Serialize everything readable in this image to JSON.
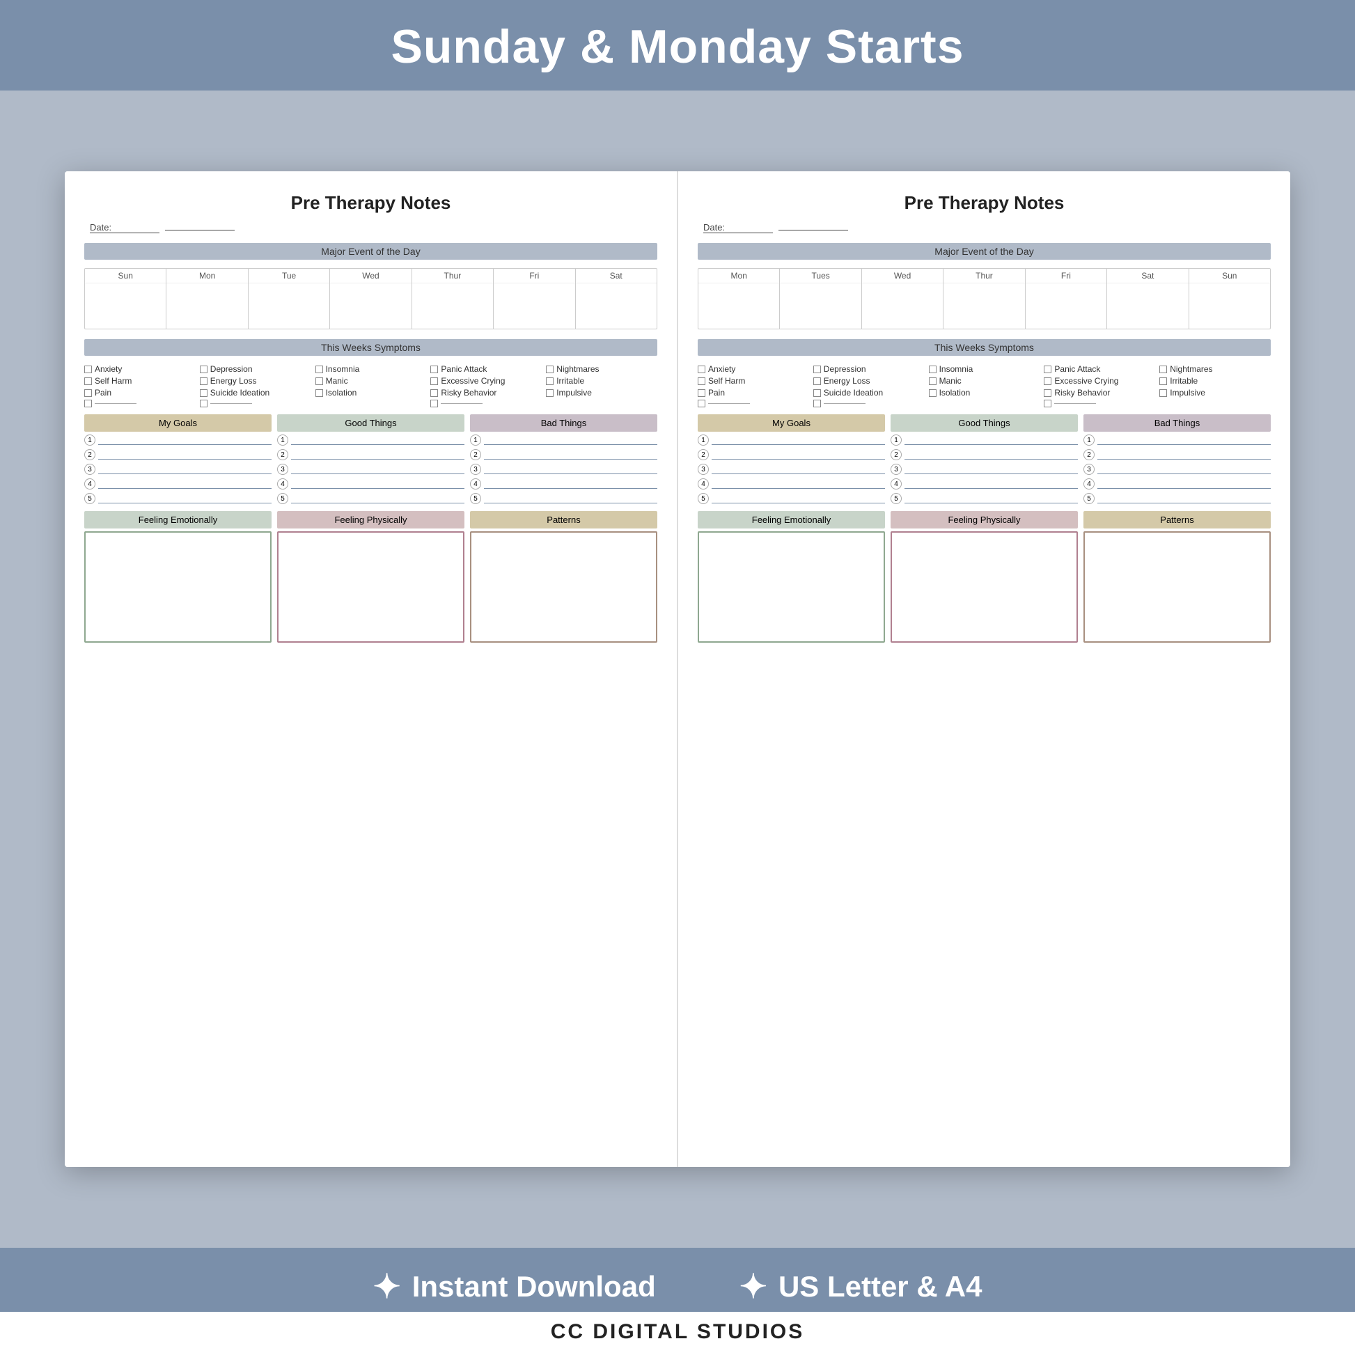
{
  "header": {
    "title": "Sunday & Monday Starts"
  },
  "left_page": {
    "title": "Pre Therapy Notes",
    "date_label": "Date:",
    "major_event_label": "Major Event of the Day",
    "days": [
      "Sun",
      "Mon",
      "Tue",
      "Wed",
      "Thur",
      "Fri",
      "Sat"
    ],
    "symptoms_label": "This Weeks Symptoms",
    "symptoms": [
      "Anxiety",
      "Depression",
      "Insomnia",
      "Panic Attack",
      "Nightmares",
      "Self Harm",
      "Energy Loss",
      "Manic",
      "Excessive Crying",
      "Irritable",
      "Pain",
      "Suicide Ideation",
      "Isolation",
      "Risky Behavior",
      "Impulsive"
    ],
    "goals_label": "My Goals",
    "good_label": "Good Things",
    "bad_label": "Bad Things",
    "list_numbers": [
      "1",
      "2",
      "3",
      "4",
      "5"
    ],
    "feeling_emotional_label": "Feeling Emotionally",
    "feeling_physical_label": "Feeling Physically",
    "patterns_label": "Patterns"
  },
  "right_page": {
    "title": "Pre Therapy Notes",
    "date_label": "Date:",
    "major_event_label": "Major Event of the Day",
    "days": [
      "Mon",
      "Tues",
      "Wed",
      "Thur",
      "Fri",
      "Sat",
      "Sun"
    ],
    "symptoms_label": "This Weeks Symptoms",
    "symptoms": [
      "Anxiety",
      "Depression",
      "Insomnia",
      "Panic Attack",
      "Nightmares",
      "Self Harm",
      "Energy Loss",
      "Manic",
      "Excessive Crying",
      "Irritable",
      "Pain",
      "Suicide Ideation",
      "Isolation",
      "Risky Behavior",
      "Impulsive"
    ],
    "goals_label": "My Goals",
    "good_label": "Good Things",
    "bad_label": "Bad Things",
    "list_numbers": [
      "1",
      "2",
      "3",
      "4",
      "5"
    ],
    "feeling_emotional_label": "Feeling Emotionally",
    "feeling_physical_label": "Feeling Physically",
    "patterns_label": "Patterns"
  },
  "footer": {
    "instant_download": "Instant Download",
    "us_letter_a4": "US Letter & A4",
    "brand": "CC DIGITAL STUDIOS"
  }
}
